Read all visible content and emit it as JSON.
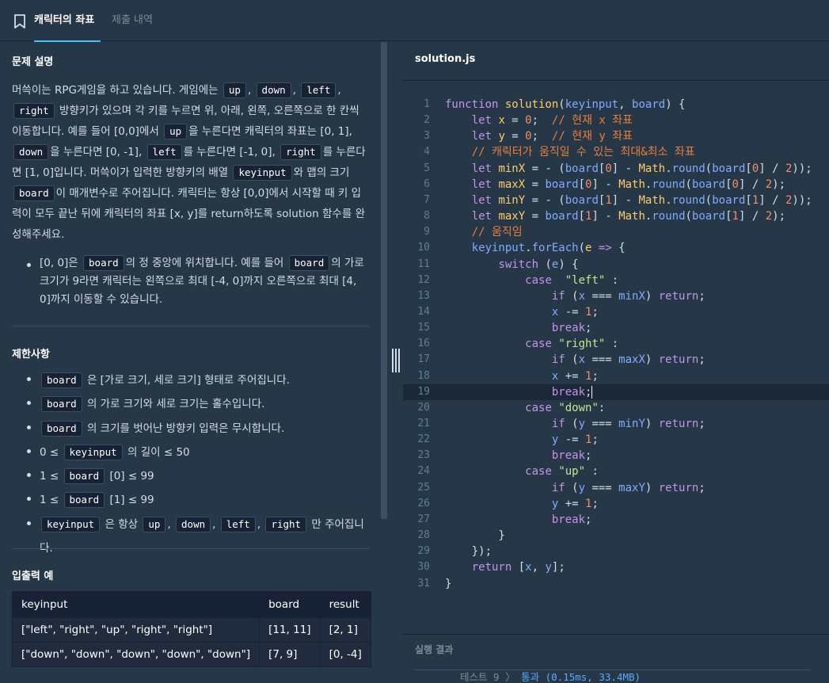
{
  "tabs": {
    "problem": "캐릭터의 좌표",
    "submissions": "제출 내역"
  },
  "description": {
    "title": "문제 설명",
    "p1": {
      "t1": "머쓱이는 RPG게임을 하고 있습니다. 게임에는",
      "c_up": "up",
      "t2": ",",
      "c_down": "down",
      "t3": ",",
      "c_left": "left",
      "t4": ",",
      "c_right": "right",
      "t5": "방향키가 있으며 각 키를 누르면 위, 아래, 왼쪽, 오른쪽으로 한 칸씩 이동합니다. 예를 들어 [0,0]에서",
      "c_up2": "up",
      "t6": "을 누른다면 캐릭터의 좌표는 [0, 1],",
      "c_down2": "down",
      "t7": "을 누른다면 [0, -1],",
      "c_left2": "left",
      "t8": "를 누른다면 [-1, 0],",
      "c_right2": "right",
      "t9": "를 누른다면 [1, 0]입니다. 머쓱이가 입력한 방향키의 배열",
      "c_keyinput": "keyinput",
      "t10": "와 맵의 크기",
      "c_board": "board",
      "t11": "이 매개변수로 주어집니다. 캐릭터는 항상 [0,0]에서 시작할 때 키 입력이 모두 끝난 뒤에 캐릭터의 좌표 [x, y]를 return하도록 solution 함수를 완성해주세요."
    },
    "bullet": {
      "t1": "[0, 0]은",
      "c_board": "board",
      "t2": "의 정 중앙에 위치합니다. 예를 들어",
      "c_board2": "board",
      "t3": "의 가로 크기가 9라면 캐릭터는 왼쪽으로 최대 [-4, 0]까지 오른쪽으로 최대 [4, 0]까지 이동할 수 있습니다."
    }
  },
  "constraints": {
    "title": "제한사항",
    "c1": {
      "code": "board",
      "text": "은 [가로 크기, 세로 크기] 형태로 주어집니다."
    },
    "c2": {
      "code": "board",
      "text": "의 가로 크기와 세로 크기는 홀수입니다."
    },
    "c3": {
      "code": "board",
      "text": "의 크기를 벗어난 방향키 입력은 무시합니다."
    },
    "c4": {
      "pre": "0 ≤",
      "code": "keyinput",
      "text": "의 길이 ≤ 50"
    },
    "c5": {
      "pre": "1 ≤",
      "code": "board",
      "text": "[0] ≤ 99"
    },
    "c6": {
      "pre": "1 ≤",
      "code": "board",
      "text": "[1] ≤ 99"
    },
    "c7": {
      "code": "keyinput",
      "t1": "은 항상",
      "k1": "up",
      "s1": ",",
      "k2": "down",
      "s2": ",",
      "k3": "left",
      "s3": ",",
      "k4": "right",
      "t2": "만 주어집니다."
    }
  },
  "io": {
    "title": "입출력 예",
    "headers": [
      "keyinput",
      "board",
      "result"
    ],
    "rows": [
      [
        "[\"left\", \"right\", \"up\", \"right\", \"right\"]",
        "[11, 11]",
        "[2, 1]"
      ],
      [
        "[\"down\", \"down\", \"down\", \"down\", \"down\"]",
        "[7, 9]",
        "[0, -4]"
      ]
    ]
  },
  "editor": {
    "filename": "solution.js",
    "line_numbers": [
      "1",
      "2",
      "3",
      "4",
      "5",
      "6",
      "7",
      "8",
      "9",
      "10",
      "11",
      "12",
      "13",
      "14",
      "15",
      "16",
      "17",
      "18",
      "19",
      "20",
      "21",
      "22",
      "23",
      "24",
      "25",
      "26",
      "27",
      "28",
      "29",
      "30",
      "31"
    ],
    "lines": [
      [
        [
          "k",
          "function "
        ],
        [
          "f",
          "solution"
        ],
        [
          "pl",
          "("
        ],
        [
          "p",
          "keyinput"
        ],
        [
          "pl",
          ", "
        ],
        [
          "p",
          "board"
        ],
        [
          "pl",
          ") {"
        ]
      ],
      [
        [
          "pl",
          "    "
        ],
        [
          "k",
          "let "
        ],
        [
          "f",
          "x"
        ],
        [
          "pl",
          " = "
        ],
        [
          "n",
          "0"
        ],
        [
          "pl",
          ";  "
        ],
        [
          "c",
          "// 현재 x 좌표"
        ]
      ],
      [
        [
          "pl",
          "    "
        ],
        [
          "k",
          "let "
        ],
        [
          "f",
          "y"
        ],
        [
          "pl",
          " = "
        ],
        [
          "n",
          "0"
        ],
        [
          "pl",
          ";  "
        ],
        [
          "c",
          "// 현재 y 좌표"
        ]
      ],
      [
        [
          "pl",
          "    "
        ],
        [
          "c",
          "// 캐릭터가 움직일 수 있는 최대&최소 좌표"
        ]
      ],
      [
        [
          "pl",
          "    "
        ],
        [
          "k",
          "let "
        ],
        [
          "f",
          "minX"
        ],
        [
          "pl",
          " = - ("
        ],
        [
          "p",
          "board"
        ],
        [
          "pl",
          "["
        ],
        [
          "n",
          "0"
        ],
        [
          "pl",
          "] - "
        ],
        [
          "f",
          "Math"
        ],
        [
          "pl",
          "."
        ],
        [
          "p",
          "round"
        ],
        [
          "pl",
          "("
        ],
        [
          "p",
          "board"
        ],
        [
          "pl",
          "["
        ],
        [
          "n",
          "0"
        ],
        [
          "pl",
          "] / "
        ],
        [
          "n",
          "2"
        ],
        [
          "pl",
          "));"
        ]
      ],
      [
        [
          "pl",
          "    "
        ],
        [
          "k",
          "let "
        ],
        [
          "f",
          "maxX"
        ],
        [
          "pl",
          " = "
        ],
        [
          "p",
          "board"
        ],
        [
          "pl",
          "["
        ],
        [
          "n",
          "0"
        ],
        [
          "pl",
          "] - "
        ],
        [
          "f",
          "Math"
        ],
        [
          "pl",
          "."
        ],
        [
          "p",
          "round"
        ],
        [
          "pl",
          "("
        ],
        [
          "p",
          "board"
        ],
        [
          "pl",
          "["
        ],
        [
          "n",
          "0"
        ],
        [
          "pl",
          "] / "
        ],
        [
          "n",
          "2"
        ],
        [
          "pl",
          ");"
        ]
      ],
      [
        [
          "pl",
          "    "
        ],
        [
          "k",
          "let "
        ],
        [
          "f",
          "minY"
        ],
        [
          "pl",
          " = - ("
        ],
        [
          "p",
          "board"
        ],
        [
          "pl",
          "["
        ],
        [
          "n",
          "1"
        ],
        [
          "pl",
          "] - "
        ],
        [
          "f",
          "Math"
        ],
        [
          "pl",
          "."
        ],
        [
          "p",
          "round"
        ],
        [
          "pl",
          "("
        ],
        [
          "p",
          "board"
        ],
        [
          "pl",
          "["
        ],
        [
          "n",
          "1"
        ],
        [
          "pl",
          "] / "
        ],
        [
          "n",
          "2"
        ],
        [
          "pl",
          "));"
        ]
      ],
      [
        [
          "pl",
          "    "
        ],
        [
          "k",
          "let "
        ],
        [
          "f",
          "maxY"
        ],
        [
          "pl",
          " = "
        ],
        [
          "p",
          "board"
        ],
        [
          "pl",
          "["
        ],
        [
          "n",
          "1"
        ],
        [
          "pl",
          "] - "
        ],
        [
          "f",
          "Math"
        ],
        [
          "pl",
          "."
        ],
        [
          "p",
          "round"
        ],
        [
          "pl",
          "("
        ],
        [
          "p",
          "board"
        ],
        [
          "pl",
          "["
        ],
        [
          "n",
          "1"
        ],
        [
          "pl",
          "] / "
        ],
        [
          "n",
          "2"
        ],
        [
          "pl",
          ");"
        ]
      ],
      [
        [
          "pl",
          "    "
        ],
        [
          "c",
          "// 움직임"
        ]
      ],
      [
        [
          "pl",
          "    "
        ],
        [
          "p",
          "keyinput"
        ],
        [
          "pl",
          "."
        ],
        [
          "p",
          "forEach"
        ],
        [
          "pl",
          "("
        ],
        [
          "f",
          "e"
        ],
        [
          "pl",
          " "
        ],
        [
          "k",
          "=>"
        ],
        [
          "pl",
          " {"
        ]
      ],
      [
        [
          "pl",
          "        "
        ],
        [
          "k",
          "switch"
        ],
        [
          "pl",
          " ("
        ],
        [
          "p",
          "e"
        ],
        [
          "pl",
          ") {"
        ]
      ],
      [
        [
          "pl",
          "            "
        ],
        [
          "k",
          "case "
        ],
        [
          "s",
          " \"left\""
        ],
        [
          "pl",
          " :"
        ]
      ],
      [
        [
          "pl",
          "                "
        ],
        [
          "k",
          "if"
        ],
        [
          "pl",
          " ("
        ],
        [
          "p",
          "x"
        ],
        [
          "pl",
          " === "
        ],
        [
          "p",
          "minX"
        ],
        [
          "pl",
          ") "
        ],
        [
          "k",
          "return"
        ],
        [
          "pl",
          ";"
        ]
      ],
      [
        [
          "pl",
          "                "
        ],
        [
          "p",
          "x"
        ],
        [
          "pl",
          " -= "
        ],
        [
          "n",
          "1"
        ],
        [
          "pl",
          ";"
        ]
      ],
      [
        [
          "pl",
          "                "
        ],
        [
          "k",
          "break"
        ],
        [
          "pl",
          ";"
        ]
      ],
      [
        [
          "pl",
          "            "
        ],
        [
          "k",
          "case "
        ],
        [
          "s",
          "\"right\""
        ],
        [
          "pl",
          " :"
        ]
      ],
      [
        [
          "pl",
          "                "
        ],
        [
          "k",
          "if"
        ],
        [
          "pl",
          " ("
        ],
        [
          "p",
          "x"
        ],
        [
          "pl",
          " === "
        ],
        [
          "p",
          "maxX"
        ],
        [
          "pl",
          ") "
        ],
        [
          "k",
          "return"
        ],
        [
          "pl",
          ";"
        ]
      ],
      [
        [
          "pl",
          "                "
        ],
        [
          "p",
          "x"
        ],
        [
          "pl",
          " += "
        ],
        [
          "n",
          "1"
        ],
        [
          "pl",
          ";"
        ]
      ],
      [
        [
          "pl",
          "                "
        ],
        [
          "k",
          "break"
        ],
        [
          "pl",
          ";"
        ]
      ],
      [
        [
          "pl",
          "            "
        ],
        [
          "k",
          "case "
        ],
        [
          "s",
          "\"down\""
        ],
        [
          "pl",
          ":"
        ]
      ],
      [
        [
          "pl",
          "                "
        ],
        [
          "k",
          "if"
        ],
        [
          "pl",
          " ("
        ],
        [
          "p",
          "y"
        ],
        [
          "pl",
          " === "
        ],
        [
          "p",
          "minY"
        ],
        [
          "pl",
          ") "
        ],
        [
          "k",
          "return"
        ],
        [
          "pl",
          ";"
        ]
      ],
      [
        [
          "pl",
          "                "
        ],
        [
          "p",
          "y"
        ],
        [
          "pl",
          " -= "
        ],
        [
          "n",
          "1"
        ],
        [
          "pl",
          ";"
        ]
      ],
      [
        [
          "pl",
          "                "
        ],
        [
          "k",
          "break"
        ],
        [
          "pl",
          ";"
        ]
      ],
      [
        [
          "pl",
          "            "
        ],
        [
          "k",
          "case "
        ],
        [
          "s",
          "\"up\""
        ],
        [
          "pl",
          " :"
        ]
      ],
      [
        [
          "pl",
          "                "
        ],
        [
          "k",
          "if"
        ],
        [
          "pl",
          " ("
        ],
        [
          "p",
          "y"
        ],
        [
          "pl",
          " === "
        ],
        [
          "p",
          "maxY"
        ],
        [
          "pl",
          ") "
        ],
        [
          "k",
          "return"
        ],
        [
          "pl",
          ";"
        ]
      ],
      [
        [
          "pl",
          "                "
        ],
        [
          "p",
          "y"
        ],
        [
          "pl",
          " += "
        ],
        [
          "n",
          "1"
        ],
        [
          "pl",
          ";"
        ]
      ],
      [
        [
          "pl",
          "                "
        ],
        [
          "k",
          "break"
        ],
        [
          "pl",
          ";"
        ]
      ],
      [
        [
          "pl",
          "        }"
        ]
      ],
      [
        [
          "pl",
          "    });"
        ]
      ],
      [
        [
          "pl",
          "    "
        ],
        [
          "k",
          "return "
        ],
        [
          "pl",
          "["
        ],
        [
          "p",
          "x"
        ],
        [
          "pl",
          ", "
        ],
        [
          "p",
          "y"
        ],
        [
          "pl",
          "];"
        ]
      ],
      [
        [
          "pl",
          "}"
        ]
      ]
    ],
    "active_line": 19
  },
  "results": {
    "title": "실행 결과",
    "test_label": "테스트 9",
    "separator": " 〉",
    "status": "통과 (0.15ms, 33.4MB)"
  }
}
